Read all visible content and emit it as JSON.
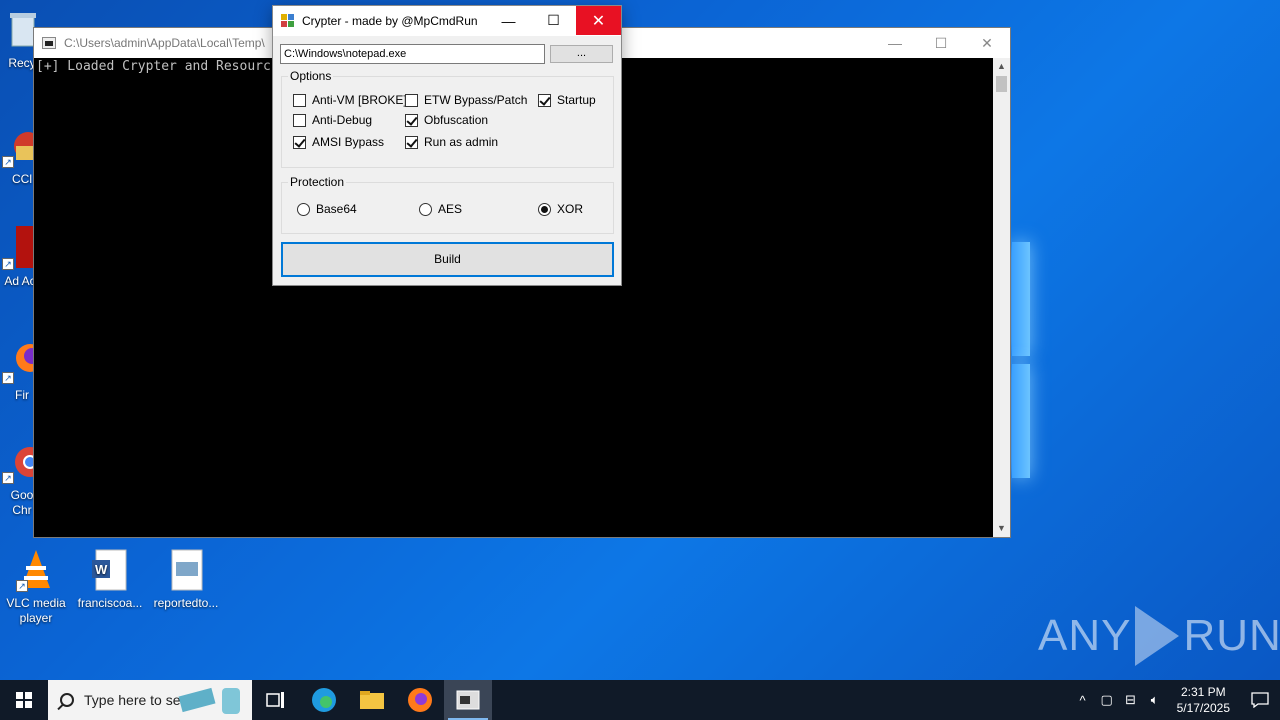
{
  "desktop": {
    "icons": [
      {
        "label": "Recy",
        "icon": "recycle-bin-icon"
      },
      {
        "label": "CCl",
        "icon": "ccleaner-icon"
      },
      {
        "label": "Ad Acr",
        "icon": "adobe-acrobat-icon"
      },
      {
        "label": "Fir",
        "icon": "firefox-icon"
      },
      {
        "label": "Goo Chr",
        "icon": "chrome-icon"
      },
      {
        "label": "VLC media player",
        "icon": "vlc-icon"
      },
      {
        "label": "franciscoa...",
        "icon": "word-doc-icon"
      },
      {
        "label": "reportedto...",
        "icon": "image-file-icon"
      }
    ]
  },
  "console": {
    "title": "C:\\Users\\admin\\AppData\\Local\\Temp\\",
    "output": "[+] Loaded Crypter and Resourc"
  },
  "dialog": {
    "title": "Crypter - made by @MpCmdRun",
    "path_value": "C:\\Windows\\notepad.exe",
    "browse_label": "...",
    "options_title": "Options",
    "options": [
      {
        "label": "Anti-VM [BROKE]",
        "checked": false
      },
      {
        "label": "ETW Bypass/Patch",
        "checked": false
      },
      {
        "label": "Startup",
        "checked": true
      },
      {
        "label": "Anti-Debug",
        "checked": false
      },
      {
        "label": "Obfuscation",
        "checked": true
      },
      {
        "label": "AMSI Bypass",
        "checked": true
      },
      {
        "label": "Run as admin",
        "checked": true
      }
    ],
    "protection_title": "Protection",
    "protection": [
      {
        "label": "Base64",
        "selected": false
      },
      {
        "label": "AES",
        "selected": false
      },
      {
        "label": "XOR",
        "selected": true
      }
    ],
    "build_label": "Build"
  },
  "watermark": {
    "left": "ANY",
    "right": "RUN"
  },
  "taskbar": {
    "search_placeholder": "Type here to search",
    "time": "2:31 PM",
    "date": "5/17/2025"
  },
  "colors": {
    "accent": "#0078d7",
    "close": "#e81123",
    "taskbar": "#101a28"
  }
}
